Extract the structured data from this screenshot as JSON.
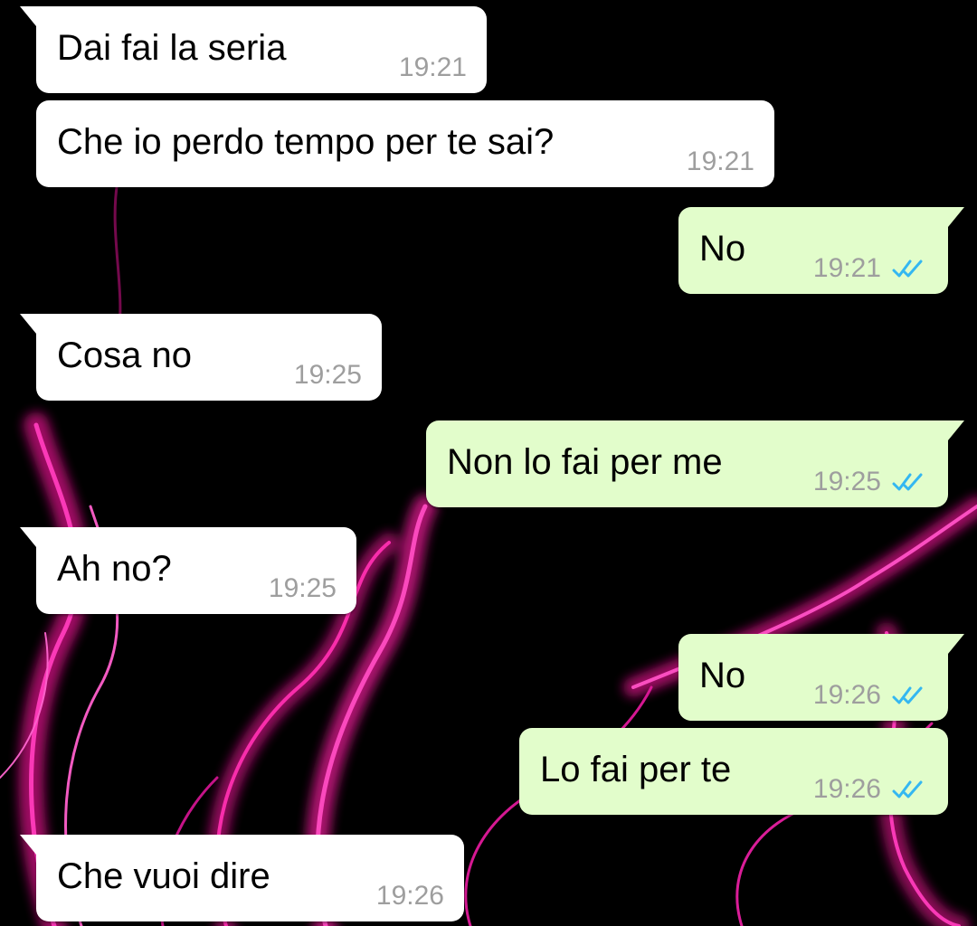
{
  "colors": {
    "background": "#000000",
    "incoming_bubble": "#ffffff",
    "outgoing_bubble": "#e2fdcb",
    "timestamp": "#9e9e9e",
    "read_ticks": "#34b7f1",
    "wallpaper_accent": "#ff1aa8"
  },
  "wallpaper": {
    "description_icon": "pink-smoke-wallpaper"
  },
  "messages": [
    {
      "direction": "incoming",
      "text": "Dai fai la seria",
      "time": "19:21"
    },
    {
      "direction": "incoming",
      "text": "Che io perdo tempo per te sai?",
      "time": "19:21"
    },
    {
      "direction": "outgoing",
      "text": "No",
      "time": "19:21",
      "status_icon": "double-check-read-icon"
    },
    {
      "direction": "incoming",
      "text": "Cosa no",
      "time": "19:25"
    },
    {
      "direction": "outgoing",
      "text": "Non lo fai per me",
      "time": "19:25",
      "status_icon": "double-check-read-icon"
    },
    {
      "direction": "incoming",
      "text": "Ah no?",
      "time": "19:25"
    },
    {
      "direction": "outgoing",
      "text": "No",
      "time": "19:26",
      "status_icon": "double-check-read-icon"
    },
    {
      "direction": "outgoing",
      "text": "Lo fai per te",
      "time": "19:26",
      "status_icon": "double-check-read-icon"
    },
    {
      "direction": "incoming",
      "text": "Che vuoi dire",
      "time": "19:26"
    }
  ]
}
